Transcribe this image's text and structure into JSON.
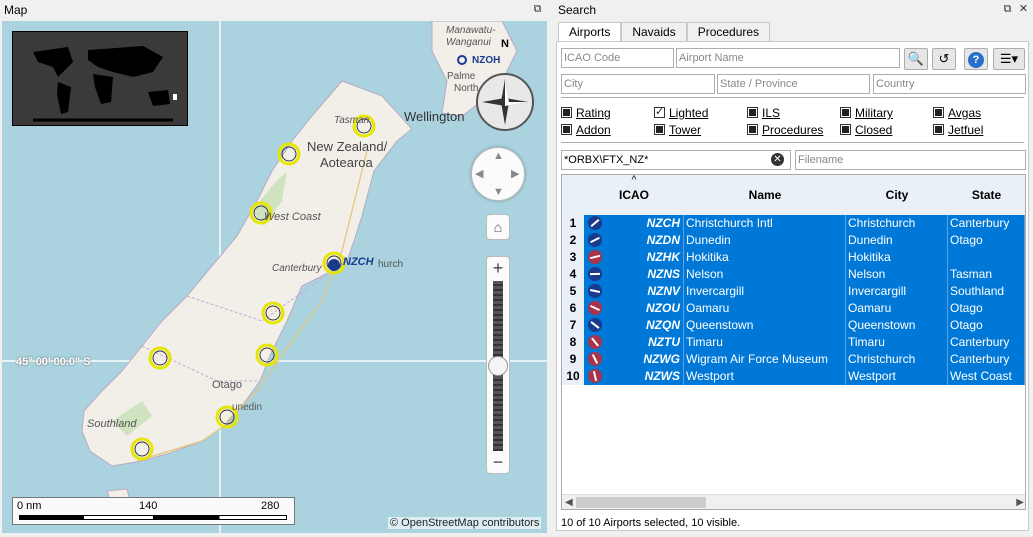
{
  "map_panel": {
    "title": "Map",
    "overview_icon": "world-overview-map",
    "compass_label": "N",
    "labels": {
      "country": "New Zealand/\nAotearoa",
      "country_line1": "New Zealand/",
      "country_line2": "Aotearoa",
      "wellington": "Wellington",
      "canterbury": "Canterbury",
      "otago": "Otago",
      "southland": "Southland",
      "west_coast": "West Coast",
      "tasman": "Tasman",
      "manawatu": "Manawatu-",
      "whanganui": "Wanganui",
      "palmerston": "Palme",
      "palmerston2": "North",
      "nzch_label": "NZCH",
      "christchurch_tail": "hurch",
      "nzoh_label": "NZOH",
      "dunedin_tail": "unedin",
      "lat_label": "45° 00' 00.0\" S"
    },
    "scale": {
      "start": "0 nm",
      "mid": "140",
      "end": "280"
    },
    "attribution": "© OpenStreetMap contributors",
    "zoom_level": 0.5
  },
  "search_panel": {
    "title": "Search",
    "tabs": [
      "Airports",
      "Navaids",
      "Procedures"
    ],
    "active_tab": "Airports",
    "fields": {
      "icao_placeholder": "ICAO Code",
      "name_placeholder": "Airport Name",
      "city_placeholder": "City",
      "state_placeholder": "State / Province",
      "country_placeholder": "Country",
      "path_value": "*ORBX\\FTX_NZ*",
      "filename_placeholder": "Filename"
    },
    "toolbar_icons": [
      "search-options-icon",
      "reset-search-icon",
      "help-icon",
      "menu-icon"
    ],
    "checkboxes": [
      {
        "label": "Rating",
        "state": "partial"
      },
      {
        "label": "Lighted",
        "state": "checked"
      },
      {
        "label": "ILS",
        "state": "partial"
      },
      {
        "label": "Military",
        "state": "partial"
      },
      {
        "label": "Avgas",
        "state": "partial"
      },
      {
        "label": "Addon",
        "state": "partial"
      },
      {
        "label": "Tower",
        "state": "partial"
      },
      {
        "label": "Procedures",
        "state": "partial"
      },
      {
        "label": "Closed",
        "state": "partial"
      },
      {
        "label": "Jetfuel",
        "state": "partial"
      }
    ],
    "table": {
      "columns": [
        "ICAO",
        "Name",
        "City",
        "State"
      ],
      "sort_indicator": "^",
      "rows": [
        {
          "num": "1",
          "icao": "NZCH",
          "name": "Christchurch Intl",
          "city": "Christchurch",
          "state": "Canterbury",
          "icon": "civil-airport-icon",
          "color": "#1a3a8c"
        },
        {
          "num": "2",
          "icao": "NZDN",
          "name": "Dunedin",
          "city": "Dunedin",
          "state": "Otago",
          "icon": "civil-airport-icon",
          "color": "#1a3a8c"
        },
        {
          "num": "3",
          "icao": "NZHK",
          "name": "Hokitika",
          "city": "Hokitika",
          "state": "",
          "icon": "unlit-airport-icon",
          "color": "#a8334a"
        },
        {
          "num": "4",
          "icao": "NZNS",
          "name": "Nelson",
          "city": "Nelson",
          "state": "Tasman",
          "icon": "civil-airport-icon",
          "color": "#1a3a8c"
        },
        {
          "num": "5",
          "icao": "NZNV",
          "name": "Invercargill",
          "city": "Invercargill",
          "state": "Southland",
          "icon": "civil-airport-icon",
          "color": "#1a3a8c"
        },
        {
          "num": "6",
          "icao": "NZOU",
          "name": "Oamaru",
          "city": "Oamaru",
          "state": "Otago",
          "icon": "unlit-airport-icon",
          "color": "#a8334a"
        },
        {
          "num": "7",
          "icao": "NZQN",
          "name": "Queenstown",
          "city": "Queenstown",
          "state": "Otago",
          "icon": "civil-airport-icon",
          "color": "#1a3a8c"
        },
        {
          "num": "8",
          "icao": "NZTU",
          "name": "Timaru",
          "city": "Timaru",
          "state": "Canterbury",
          "icon": "unlit-airport-icon",
          "color": "#a8334a"
        },
        {
          "num": "9",
          "icao": "NZWG",
          "name": "Wigram Air Force Museum",
          "city": "Christchurch",
          "state": "Canterbury",
          "icon": "military-airport-icon",
          "color": "#a8334a"
        },
        {
          "num": "10",
          "icao": "NZWS",
          "name": "Westport",
          "city": "Westport",
          "state": "West Coast",
          "icon": "unlit-airport-icon",
          "color": "#a8334a"
        }
      ]
    },
    "status": "10 of 10 Airports selected, 10 visible."
  }
}
